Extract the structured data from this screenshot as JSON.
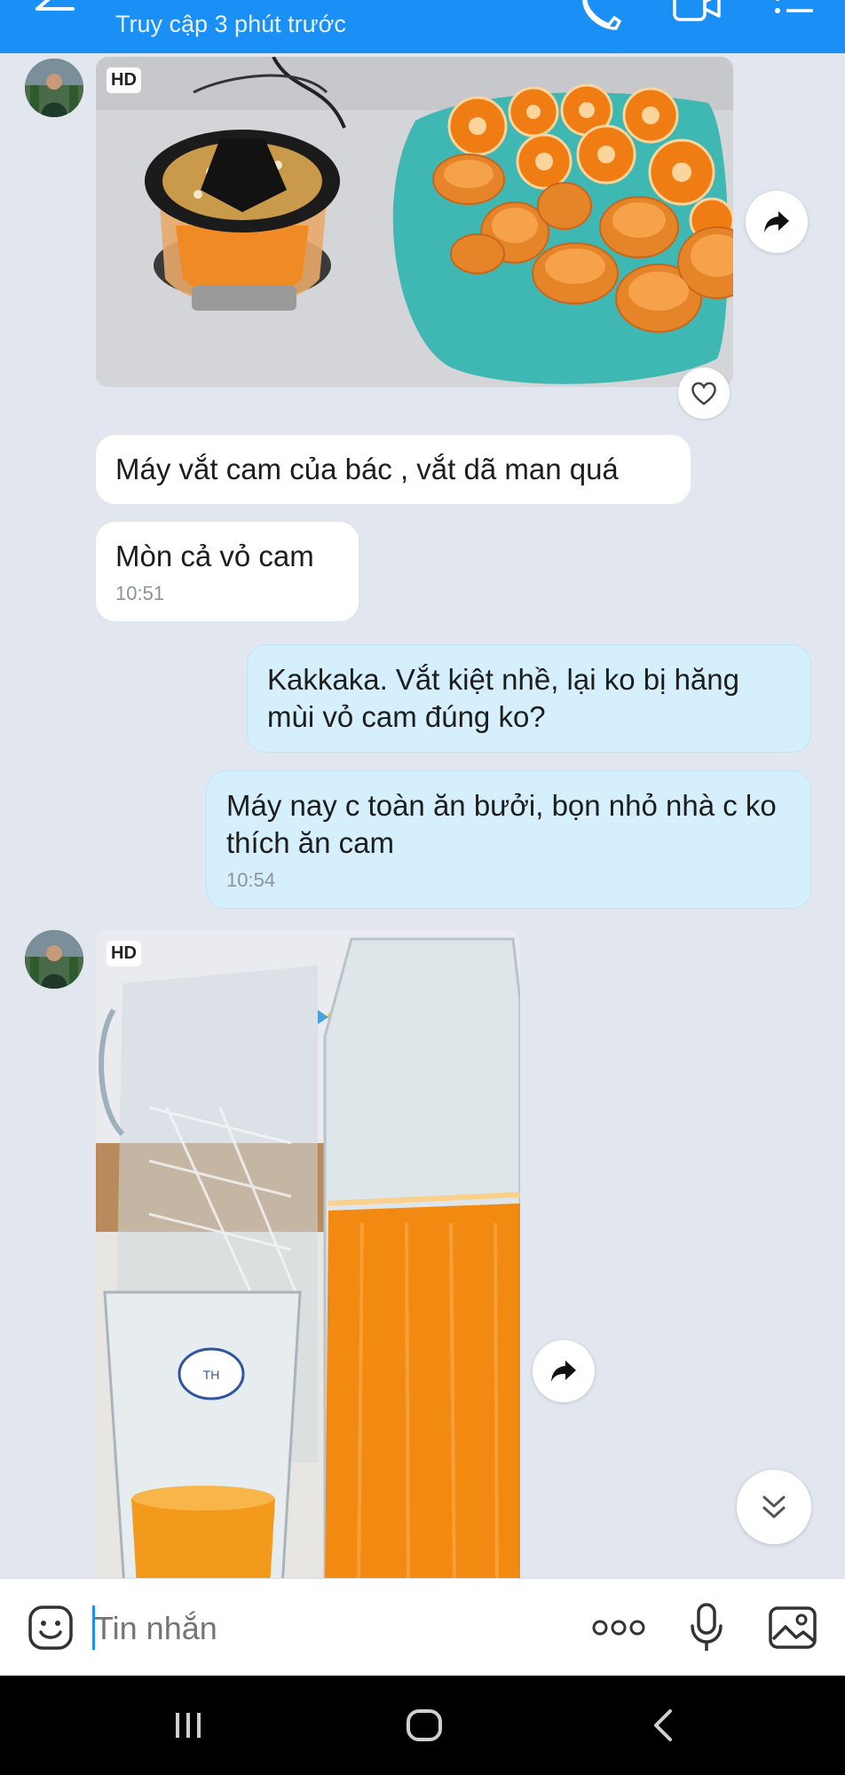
{
  "header": {
    "subtitle": "Truy cập 3 phút trước",
    "icons": [
      "back-arrow-icon",
      "phone-icon",
      "video-call-icon",
      "menu-list-icon"
    ],
    "background": "#1a8ff5"
  },
  "messages": [
    {
      "type": "image",
      "from": "other",
      "badge": "HD",
      "actions": [
        "share-icon",
        "heart-icon"
      ]
    },
    {
      "type": "text",
      "from": "other",
      "text": "Máy vắt cam của bác , vắt dã man quá"
    },
    {
      "type": "text",
      "from": "other",
      "text": "Mòn cả vỏ cam",
      "time": "10:51"
    },
    {
      "type": "text",
      "from": "me",
      "text": "Kakkaka. Vắt kiệt nhề, lại ko bị hăng mùi vỏ cam đúng ko?"
    },
    {
      "type": "text",
      "from": "me",
      "text": "Máy nay c toàn ăn bưởi, bọn nhỏ nhà c ko thích ăn cam",
      "time": "10:54"
    },
    {
      "type": "image",
      "from": "other",
      "badge": "HD",
      "actions": [
        "share-icon"
      ]
    }
  ],
  "composer": {
    "placeholder": "Tin nhắn",
    "icons": [
      "sticker-icon",
      "more-options-icon",
      "microphone-icon",
      "gallery-icon"
    ]
  },
  "colors": {
    "chat_bg": "#e1e6ef",
    "incoming_bubble": "#ffffff",
    "outgoing_bubble": "#d5effd",
    "time_text": "#8b949c"
  },
  "system_nav": [
    "recent-apps-icon",
    "home-icon",
    "back-icon"
  ]
}
